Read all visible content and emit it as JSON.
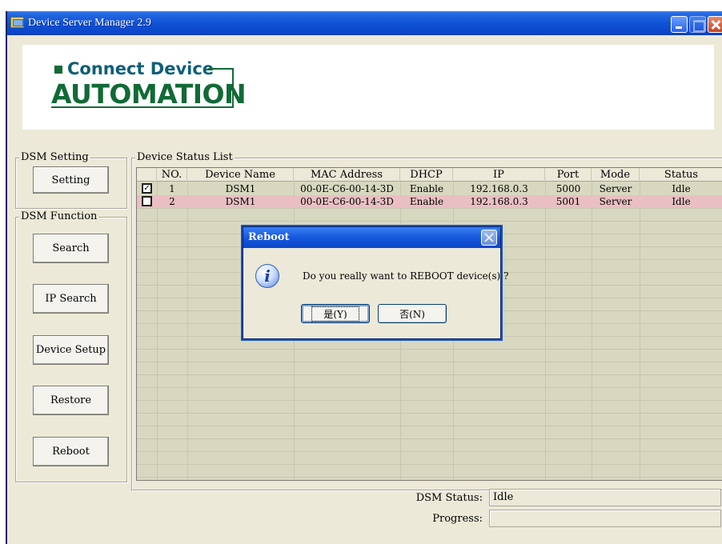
{
  "window": {
    "title": "Device Server Manager 2.9"
  },
  "logo": {
    "line1": "Connect Device",
    "line2": "AUTOMATION"
  },
  "dsm_setting": {
    "legend": "DSM Setting",
    "setting_label": "Setting"
  },
  "dsm_function": {
    "legend": "DSM Function",
    "buttons": [
      "Search",
      "IP Search",
      "Device Setup",
      "Restore",
      "Reboot"
    ]
  },
  "device_list": {
    "legend": "Device Status List",
    "columns": [
      "NO.",
      "Device Name",
      "MAC Address",
      "DHCP",
      "IP",
      "Port",
      "Mode",
      "Status"
    ],
    "rows": [
      {
        "checked": true,
        "checkmark": "✓",
        "no": "1",
        "name": "DSM1",
        "mac": "00-0E-C6-00-14-3D",
        "dhcp": "Enable",
        "ip": "192.168.0.3",
        "port": "5000",
        "mode": "Server",
        "status": "Idle"
      },
      {
        "checked": false,
        "checkmark": "",
        "no": "2",
        "name": "DSM1",
        "mac": "00-0E-C6-00-14-3D",
        "dhcp": "Enable",
        "ip": "192.168.0.3",
        "port": "5001",
        "mode": "Server",
        "status": "Idle"
      }
    ]
  },
  "status_bar": {
    "dsm_status_label": "DSM Status:",
    "dsm_status_value": "Idle",
    "progress_label": "Progress:",
    "progress_value": ""
  },
  "dialog": {
    "title": "Reboot",
    "message": "Do you really want to REBOOT device(s) ?",
    "yes_label": "是(Y)",
    "no_label": "否(N)"
  },
  "colors": {
    "title_bar": "#0b46c9",
    "selected_row": "#e9bfc3",
    "logo_green": "#116a36",
    "logo_blue": "#0d5e7a"
  }
}
